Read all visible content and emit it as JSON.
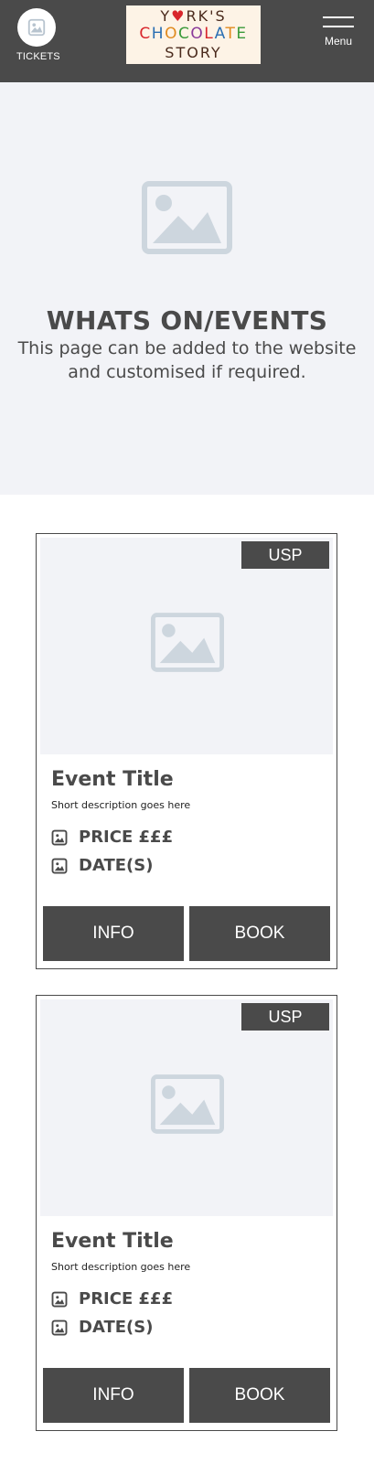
{
  "header": {
    "tickets_label": "TICKETS",
    "tickets_icon": "image-icon",
    "logo": {
      "line1": "YORK'S",
      "line2": "CHOCOLATE",
      "line3": "STORY"
    },
    "menu_label": "Menu",
    "background": "#4a4a4a"
  },
  "hero": {
    "title": "WHATS ON/EVENTS",
    "subtitle": "This page can be added to the website and customised if required.",
    "background": "#f2f3f7"
  },
  "cards": [
    {
      "usp": "USP",
      "title": "Event Title",
      "description": "Short description goes here",
      "price": "PRICE £££",
      "dates": "DATE(S)",
      "info_label": "INFO",
      "book_label": "BOOK"
    },
    {
      "usp": "USP",
      "title": "Event Title",
      "description": "Short description goes here",
      "price": "PRICE £££",
      "dates": "DATE(S)",
      "info_label": "INFO",
      "book_label": "BOOK"
    }
  ],
  "colors": {
    "dark": "#4a4a4a",
    "placeholder": "#f2f3f7",
    "placeholder_icon": "#cdd6de"
  }
}
